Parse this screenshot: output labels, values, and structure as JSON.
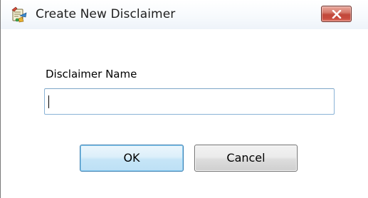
{
  "window": {
    "title": "Create New Disclaimer",
    "icon": "disclaimer-app-icon",
    "close_icon": "close-icon"
  },
  "form": {
    "name_label": "Disclaimer Name",
    "name_value": "",
    "ok_label": "OK",
    "cancel_label": "Cancel"
  },
  "colors": {
    "close_button": "#c8493c",
    "ok_border": "#3c7fb1",
    "input_border": "#8ab3d6"
  }
}
